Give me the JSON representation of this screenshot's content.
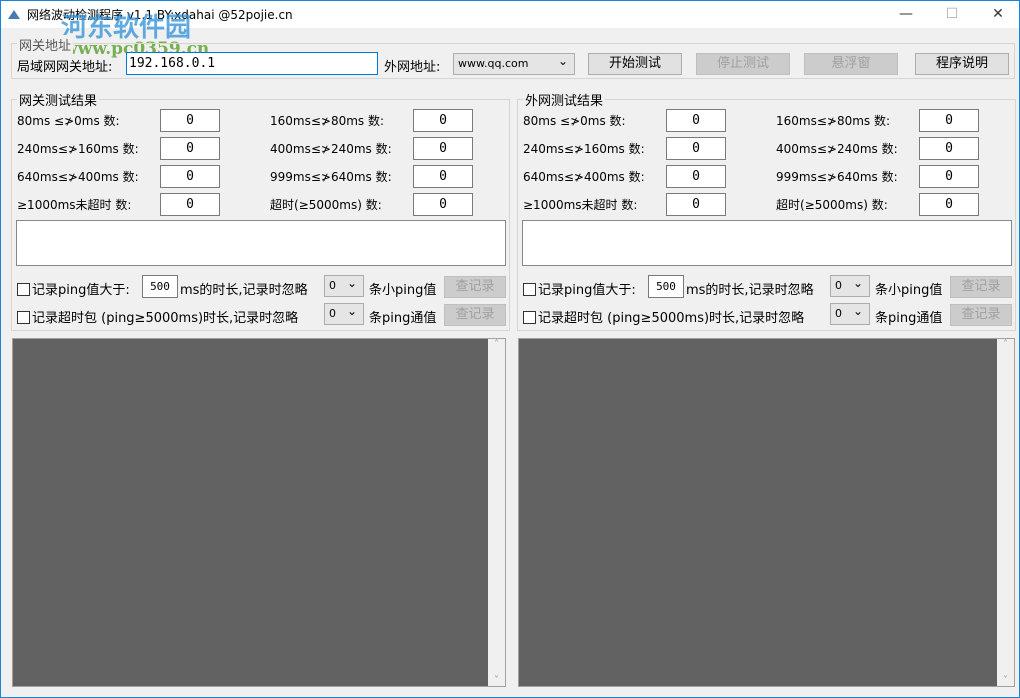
{
  "window": {
    "title": "网络波动检测程序 v1.1  BY:xdahai  @52pojie.cn",
    "minimize": "—",
    "maximize": "☐",
    "close": "✕"
  },
  "watermark": {
    "name": "河东软件园",
    "url": "www.pc0359.cn"
  },
  "address": {
    "group_label": "网关地址",
    "gateway_label": "局域网网关地址:",
    "gateway_value": "192.168.0.1",
    "external_label": "外网地址:",
    "external_value": "www.qq.com",
    "start": "开始测试",
    "stop": "停止测试",
    "float": "悬浮窗",
    "help": "程序说明"
  },
  "panels": [
    {
      "title": "网关测试结果",
      "rows": [
        {
          "label": "80ms ≤≯0ms  数:",
          "value": "0"
        },
        {
          "label": "160ms≤≯80ms  数:",
          "value": "0"
        },
        {
          "label": "240ms≤≯160ms 数:",
          "value": "0"
        },
        {
          "label": "400ms≤≯240ms 数:",
          "value": "0"
        },
        {
          "label": "640ms≤≯400ms 数:",
          "value": "0"
        },
        {
          "label": "999ms≤≯640ms 数:",
          "value": "0"
        },
        {
          "label": "≥1000ms未超时 数:",
          "value": "0"
        },
        {
          "label": "超时(≥5000ms) 数:",
          "value": "0"
        }
      ],
      "rec1_a": "记录ping值大于:",
      "rec1_value": "500",
      "rec1_b": "ms的时长,记录时忽略",
      "rec1_sel": "0",
      "rec1_c": "条小ping值",
      "rec1_btn": "查记录",
      "rec2_a": "记录超时包 (ping≥5000ms)时长,记录时忽略",
      "rec2_sel": "0",
      "rec2_c": "条ping通值",
      "rec2_btn": "查记录"
    },
    {
      "title": "外网测试结果",
      "rows": [
        {
          "label": "80ms ≤≯0ms  数:",
          "value": "0"
        },
        {
          "label": "160ms≤≯80ms  数:",
          "value": "0"
        },
        {
          "label": "240ms≤≯160ms 数:",
          "value": "0"
        },
        {
          "label": "400ms≤≯240ms 数:",
          "value": "0"
        },
        {
          "label": "640ms≤≯400ms 数:",
          "value": "0"
        },
        {
          "label": "999ms≤≯640ms 数:",
          "value": "0"
        },
        {
          "label": "≥1000ms未超时 数:",
          "value": "0"
        },
        {
          "label": "超时(≥5000ms) 数:",
          "value": "0"
        }
      ],
      "rec1_a": "记录ping值大于:",
      "rec1_value": "500",
      "rec1_b": "ms的时长,记录时忽略",
      "rec1_sel": "0",
      "rec1_c": "条小ping值",
      "rec1_btn": "查记录",
      "rec2_a": "记录超时包 (ping≥5000ms)时长,记录时忽略",
      "rec2_sel": "0",
      "rec2_c": "条ping通值",
      "rec2_btn": "查记录"
    }
  ]
}
